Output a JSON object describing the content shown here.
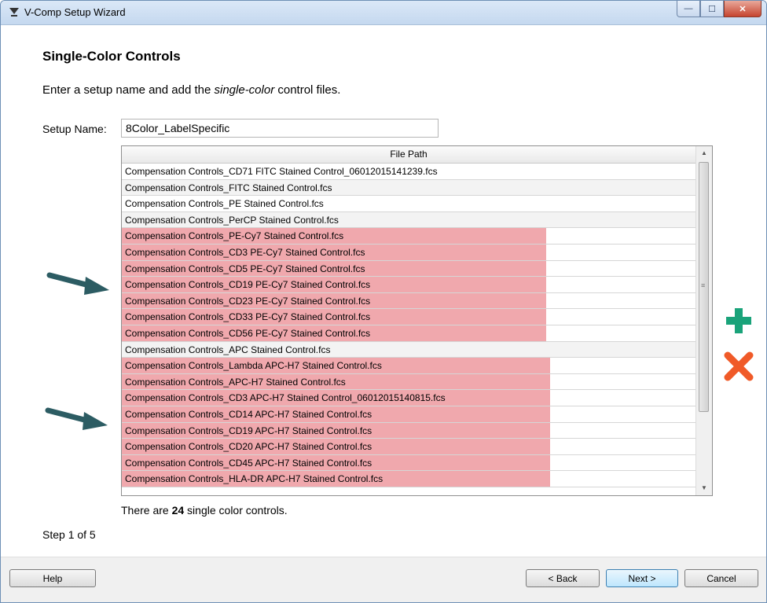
{
  "window": {
    "title": "V-Comp Setup Wizard",
    "buttons": {
      "minimize": "—",
      "maximize": "☐",
      "close": "✕"
    }
  },
  "page": {
    "heading": "Single-Color Controls",
    "instruction_before": "Enter a setup name and add the ",
    "instruction_italic": "single-color",
    "instruction_after": " control files.",
    "setup_name_label": "Setup Name:",
    "setup_name_value": "8Color_LabelSpecific"
  },
  "table": {
    "column_header": "File Path",
    "rows": [
      {
        "path": "Compensation Controls_CD71 FITC Stained Control_06012015141239.fcs",
        "highlight": "none"
      },
      {
        "path": "Compensation Controls_FITC Stained Control.fcs",
        "highlight": "none"
      },
      {
        "path": "Compensation Controls_PE Stained Control.fcs",
        "highlight": "none"
      },
      {
        "path": "Compensation Controls_PerCP Stained Control.fcs",
        "highlight": "none"
      },
      {
        "path": "Compensation Controls_PE-Cy7 Stained Control.fcs",
        "highlight": "group1"
      },
      {
        "path": "Compensation Controls_CD3 PE-Cy7 Stained Control.fcs",
        "highlight": "group1"
      },
      {
        "path": "Compensation Controls_CD5 PE-Cy7 Stained Control.fcs",
        "highlight": "group1"
      },
      {
        "path": "Compensation Controls_CD19 PE-Cy7 Stained Control.fcs",
        "highlight": "group1"
      },
      {
        "path": "Compensation Controls_CD23 PE-Cy7 Stained Control.fcs",
        "highlight": "group1"
      },
      {
        "path": "Compensation Controls_CD33 PE-Cy7 Stained Control.fcs",
        "highlight": "group1"
      },
      {
        "path": "Compensation Controls_CD56 PE-Cy7 Stained Control.fcs",
        "highlight": "group1"
      },
      {
        "path": "Compensation Controls_APC Stained Control.fcs",
        "highlight": "none"
      },
      {
        "path": "Compensation Controls_Lambda APC-H7 Stained Control.fcs",
        "highlight": "group2"
      },
      {
        "path": "Compensation Controls_APC-H7 Stained Control.fcs",
        "highlight": "group2"
      },
      {
        "path": "Compensation Controls_CD3 APC-H7 Stained Control_06012015140815.fcs",
        "highlight": "group2"
      },
      {
        "path": "Compensation Controls_CD14 APC-H7 Stained Control.fcs",
        "highlight": "group2"
      },
      {
        "path": "Compensation Controls_CD19 APC-H7 Stained Control.fcs",
        "highlight": "group2"
      },
      {
        "path": "Compensation Controls_CD20 APC-H7 Stained Control.fcs",
        "highlight": "group2"
      },
      {
        "path": "Compensation Controls_CD45 APC-H7 Stained Control.fcs",
        "highlight": "group2"
      },
      {
        "path": "Compensation Controls_HLA-DR APC-H7 Stained Control.fcs",
        "highlight": "group2"
      }
    ]
  },
  "summary": {
    "count_before": "There are ",
    "count_value": "24",
    "count_after": " single color controls.",
    "step": "Step 1 of 5"
  },
  "buttons": {
    "help": "Help",
    "back": "< Back",
    "next": "Next >",
    "cancel": "Cancel"
  },
  "colors": {
    "highlight": "#f0a8ad",
    "add_icon": "#1aa37a",
    "remove_icon": "#f05a28",
    "annotation_arrow": "#2c5c63"
  },
  "icons": {
    "add": "plus-icon",
    "remove": "x-icon",
    "annotation": "arrow-icon"
  }
}
